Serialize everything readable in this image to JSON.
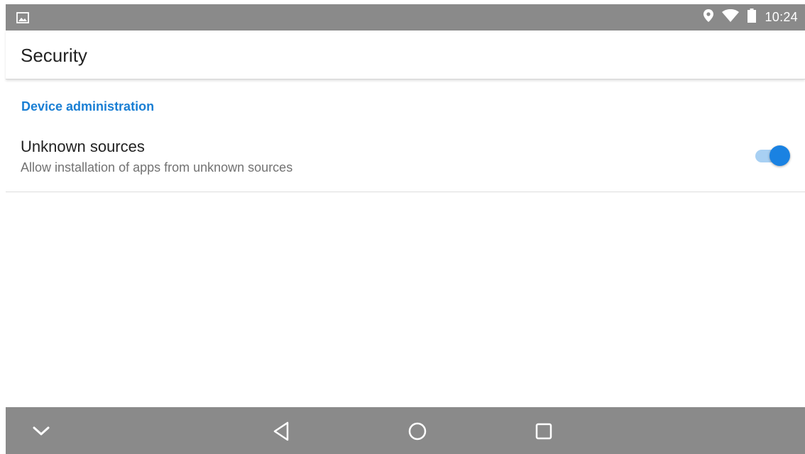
{
  "status_bar": {
    "time": "10:24",
    "icons": [
      "image-notification-icon",
      "location-icon",
      "wifi-icon",
      "battery-icon"
    ]
  },
  "toolbar": {
    "title": "Security"
  },
  "section": {
    "header": "Device administration"
  },
  "preference": {
    "title": "Unknown sources",
    "summary": "Allow installation of apps from unknown sources",
    "enabled": true
  },
  "nav_bar": {
    "buttons": [
      "collapse-icon",
      "back-icon",
      "home-icon",
      "recents-icon"
    ]
  },
  "colors": {
    "accent": "#1a82e2",
    "section_header": "#1a7fd4",
    "switch_track": "#a8d0f3",
    "system_bar": "#8a8a8a"
  }
}
